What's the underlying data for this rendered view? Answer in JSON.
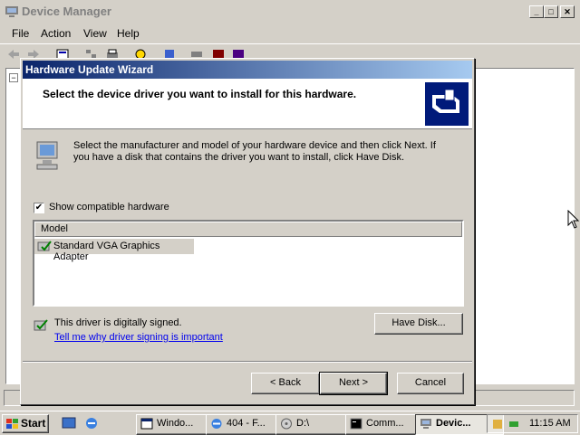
{
  "device_manager": {
    "title": "Device Manager",
    "menu": [
      "File",
      "Action",
      "View",
      "Help"
    ],
    "window_controls": {
      "minimize": "_",
      "maximize": "□",
      "close": "✕"
    }
  },
  "wizard": {
    "title": "Hardware Update Wizard",
    "heading": "Select the device driver you want to install for this hardware.",
    "instructions": "Select the manufacturer and model of your hardware device and then click Next. If you have a disk that contains the driver you want to install, click Have Disk.",
    "show_compatible_label": "Show compatible hardware",
    "show_compatible_checked": true,
    "model_header": "Model",
    "models": [
      "Standard VGA Graphics Adapter"
    ],
    "signed_text": "This driver is digitally signed.",
    "signing_link": "Tell me why driver signing is important",
    "have_disk_label": "Have Disk...",
    "back_label": "< Back",
    "next_label": "Next >",
    "cancel_label": "Cancel"
  },
  "taskbar": {
    "start_label": "Start",
    "items": [
      "Windo...",
      "404 - F...",
      "D:\\",
      "Comm...",
      "Devic..."
    ],
    "active_index": 4,
    "clock": "11:15 AM"
  },
  "colors": {
    "title_active_start": "#0a246a",
    "title_active_end": "#a6caf0",
    "face": "#d4d0c8",
    "link": "#0000ee"
  }
}
